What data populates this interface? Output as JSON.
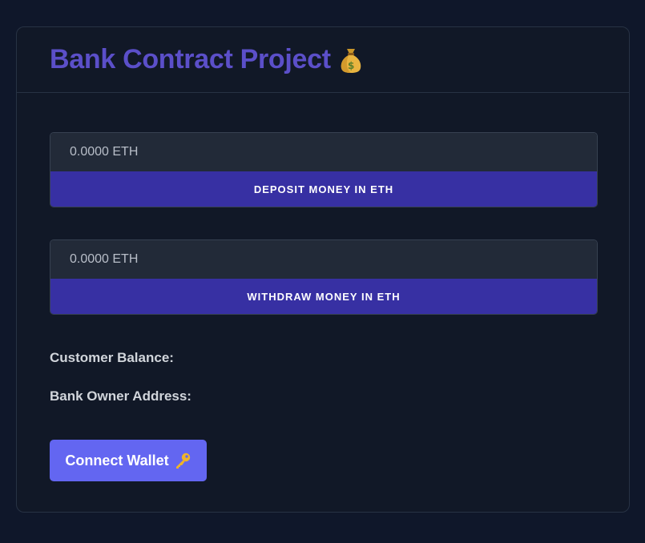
{
  "header": {
    "title": "Bank Contract Project",
    "title_icon": "money-bag-icon",
    "title_color": "#5b4fc9"
  },
  "deposit": {
    "input_placeholder": "0.0000 ETH",
    "input_value": "",
    "button_label": "DEPOSIT MONEY IN ETH"
  },
  "withdraw": {
    "input_placeholder": "0.0000 ETH",
    "input_value": "",
    "button_label": "WITHDRAW MONEY IN ETH"
  },
  "info": {
    "customer_balance_label": "Customer Balance:",
    "customer_balance_value": "",
    "bank_owner_label": "Bank Owner Address:",
    "bank_owner_value": ""
  },
  "wallet": {
    "connect_label": "Connect Wallet",
    "connect_icon": "key-icon",
    "button_color": "#6366f1"
  },
  "colors": {
    "background": "#0f172a",
    "card": "#111827",
    "action_button": "#3730a3"
  }
}
